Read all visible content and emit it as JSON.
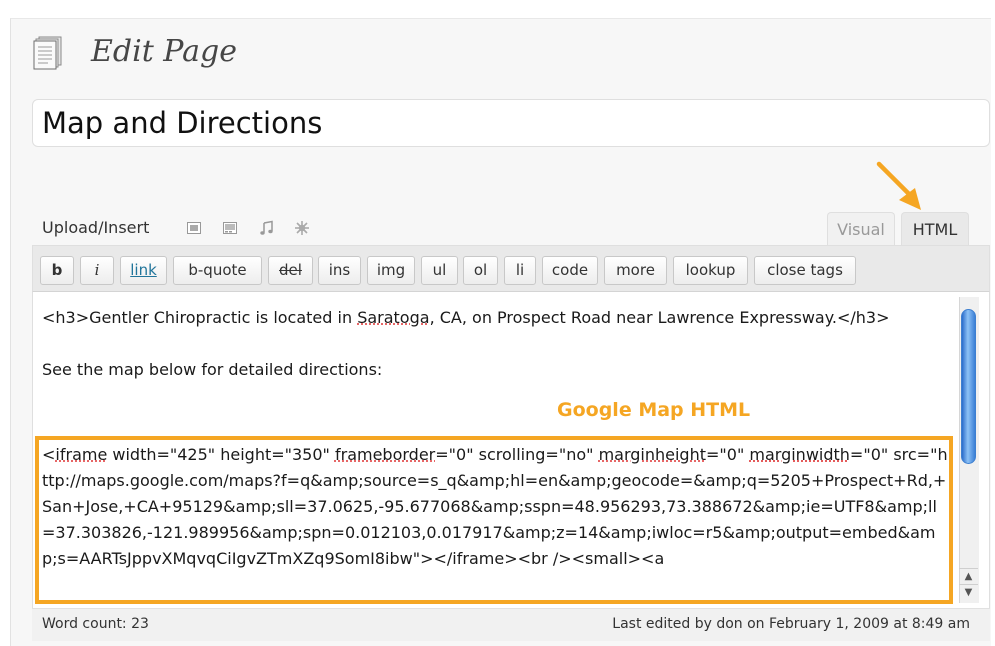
{
  "page": {
    "title": "Edit Page"
  },
  "post": {
    "title": "Map and Directions"
  },
  "media": {
    "label": "Upload/Insert",
    "icons": [
      "image-icon",
      "video-icon",
      "audio-icon",
      "media-icon"
    ]
  },
  "tabs": {
    "visual": "Visual",
    "html": "HTML"
  },
  "quicktags": [
    "b",
    "i",
    "link",
    "b-quote",
    "del",
    "ins",
    "img",
    "ul",
    "ol",
    "li",
    "code",
    "more",
    "lookup",
    "close tags"
  ],
  "content": {
    "h3_prefix": "<h3>Gentler Chiropractic is located in ",
    "saratoga": "Saratoga",
    "h3_suffix": ", CA, on Prospect Road near Lawrence Expressway.</h3>",
    "paragraph": "See the map below for detailed directions:",
    "annotation": "Google Map HTML",
    "iframe_open": "<",
    "iframe_word": "iframe",
    "iframe_attrs1": " width=\"425\" height=\"350\" ",
    "frameborder": "frameborder",
    "iframe_attrs2": "=\"0\" scrolling=\"no\" ",
    "marginheight": "marginheight",
    "iframe_attrs3": "=\"0\" ",
    "marginwidth": "marginwidth",
    "iframe_rest": "=\"0\" src=\"http://maps.google.com/maps?f=q&amp;source=s_q&amp;hl=en&amp;geocode=&amp;q=5205+Prospect+Rd,+San+Jose,+CA+95129&amp;sll=37.0625,-95.677068&amp;sspn=48.956293,73.388672&amp;ie=UTF8&amp;ll=37.303826,-121.989956&amp;spn=0.012103,0.017917&amp;z=14&amp;iwloc=r5&amp;output=embed&amp;s=AARTsJppvXMqvqCiIgvZTmXZq9SomI8ibw\"></iframe><br /><small><a"
  },
  "status": {
    "word_count": "Word count: 23",
    "last_edited": "Last edited by don on February 1, 2009 at 8:49 am"
  },
  "colors": {
    "annotation": "#f5a623",
    "link": "#21759b"
  }
}
